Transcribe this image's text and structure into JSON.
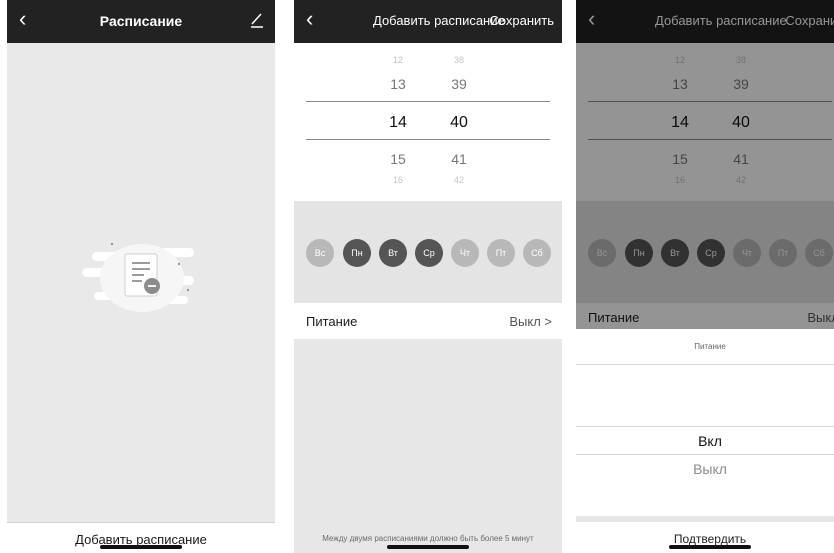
{
  "screen1": {
    "back_icon": "‹",
    "title": "Расписание",
    "edit_icon": "pencil-icon",
    "add_button": "Добавить расписание"
  },
  "screen2": {
    "back_icon": "‹",
    "title": "Добавить расписание",
    "save_label": "Сохранить",
    "picker": {
      "hours": [
        "12",
        "13",
        "14",
        "15",
        "16"
      ],
      "minutes": [
        "38",
        "39",
        "40",
        "41",
        "42"
      ]
    },
    "days": [
      {
        "label": "Вс",
        "active": false
      },
      {
        "label": "Пн",
        "active": true
      },
      {
        "label": "Вт",
        "active": true
      },
      {
        "label": "Ср",
        "active": true
      },
      {
        "label": "Чт",
        "active": false
      },
      {
        "label": "Пт",
        "active": false
      },
      {
        "label": "Сб",
        "active": false
      }
    ],
    "power_label": "Питание",
    "power_value": "Выкл >",
    "note": "Между двумя расписаниями должно быть более 5 минут"
  },
  "screen3": {
    "back_icon": "‹",
    "title": "Добавить расписание",
    "save_label": "Сохранить",
    "picker": {
      "hours": [
        "12",
        "13",
        "14",
        "15",
        "16"
      ],
      "minutes": [
        "38",
        "39",
        "40",
        "41",
        "42"
      ]
    },
    "days": [
      {
        "label": "Вс",
        "active": false
      },
      {
        "label": "Пн",
        "active": true
      },
      {
        "label": "Вт",
        "active": true
      },
      {
        "label": "Ср",
        "active": true
      },
      {
        "label": "Чт",
        "active": false
      },
      {
        "label": "Пт",
        "active": false
      },
      {
        "label": "Сб",
        "active": false
      }
    ],
    "power_label": "Питание",
    "power_value": "Выкл >",
    "sheet": {
      "title": "Питание",
      "option_selected": "Вкл",
      "option_other": "Выкл",
      "confirm_label": "Подтвердить"
    }
  },
  "colors": {
    "topbar": "#222222",
    "day_active": "#555555",
    "day_inactive": "#b8b8b8"
  }
}
